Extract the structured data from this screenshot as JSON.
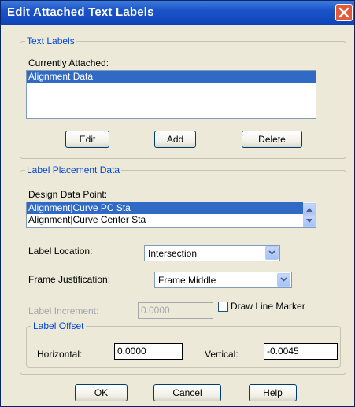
{
  "window": {
    "title": "Edit Attached Text Labels"
  },
  "text_labels": {
    "legend": "Text Labels",
    "currently_attached_label": "Currently Attached:",
    "items": [
      {
        "label": "Alignment Data",
        "selected": true
      }
    ],
    "edit_label": "Edit",
    "add_label": "Add",
    "delete_label": "Delete"
  },
  "placement": {
    "legend": "Label Placement Data",
    "design_point_label": "Design Data Point:",
    "design_points": [
      {
        "label": "Alignment|Curve PC Sta",
        "selected": true
      },
      {
        "label": "Alignment|Curve Center Sta",
        "selected": false
      }
    ],
    "label_location_label": "Label Location:",
    "label_location_value": "Intersection",
    "frame_justification_label": "Frame Justification:",
    "frame_justification_value": "Frame Middle",
    "label_increment_label": "Label Increment:",
    "label_increment_value": "0.0000",
    "draw_line_marker_label": "Draw Line Marker",
    "draw_line_marker_checked": false,
    "offset": {
      "legend": "Label Offset",
      "horizontal_label": "Horizontal:",
      "horizontal_value": "0.0000",
      "vertical_label": "Vertical:",
      "vertical_value": "-0.0045"
    }
  },
  "buttons": {
    "ok": "OK",
    "cancel": "Cancel",
    "help": "Help"
  },
  "colors": {
    "title_bar": "#1a53c8",
    "selection": "#316ac5",
    "group_legend": "#0046d5",
    "dialog_bg": "#ece9d8"
  }
}
